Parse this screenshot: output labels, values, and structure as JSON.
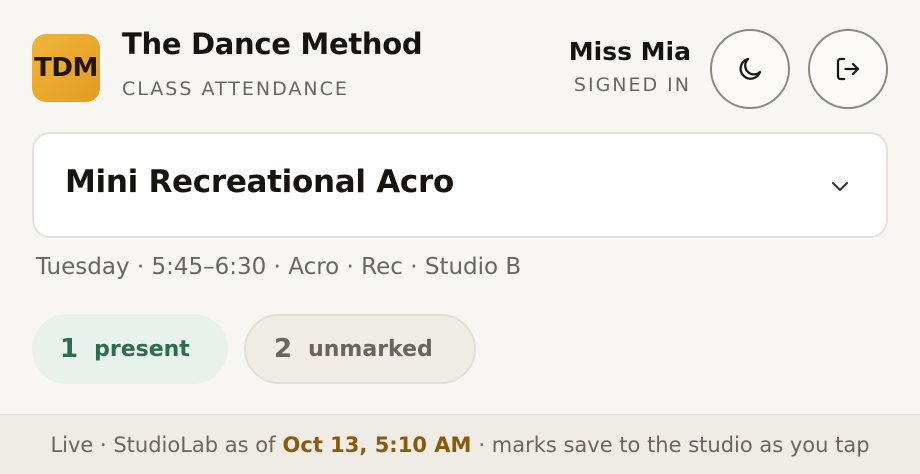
{
  "brand": {
    "logo_text": "TDM",
    "name": "The Dance Method",
    "subtitle": "CLASS ATTENDANCE"
  },
  "user": {
    "name": "Miss Mia",
    "status": "SIGNED IN"
  },
  "icons": {
    "theme": "moon-icon",
    "logout": "logout-icon",
    "dropdown": "chevron-down-icon"
  },
  "class": {
    "name": "Mini Recreational Acro",
    "meta": "Tuesday · 5:45–6:30 · Acro · Rec · Studio B"
  },
  "counts": {
    "present": {
      "count": "1",
      "label": "present"
    },
    "unmarked": {
      "count": "2",
      "label": "unmarked"
    }
  },
  "footer": {
    "prefix": "Live · StudioLab as of",
    "timestamp": "Oct 13, 5:10 AM",
    "suffix": "· marks save to the studio as you tap"
  },
  "colors": {
    "accent": "#e9a72c",
    "present_text": "#2b6e48",
    "present_bg": "#e8f1ec",
    "timestamp": "#8a5a0c"
  }
}
